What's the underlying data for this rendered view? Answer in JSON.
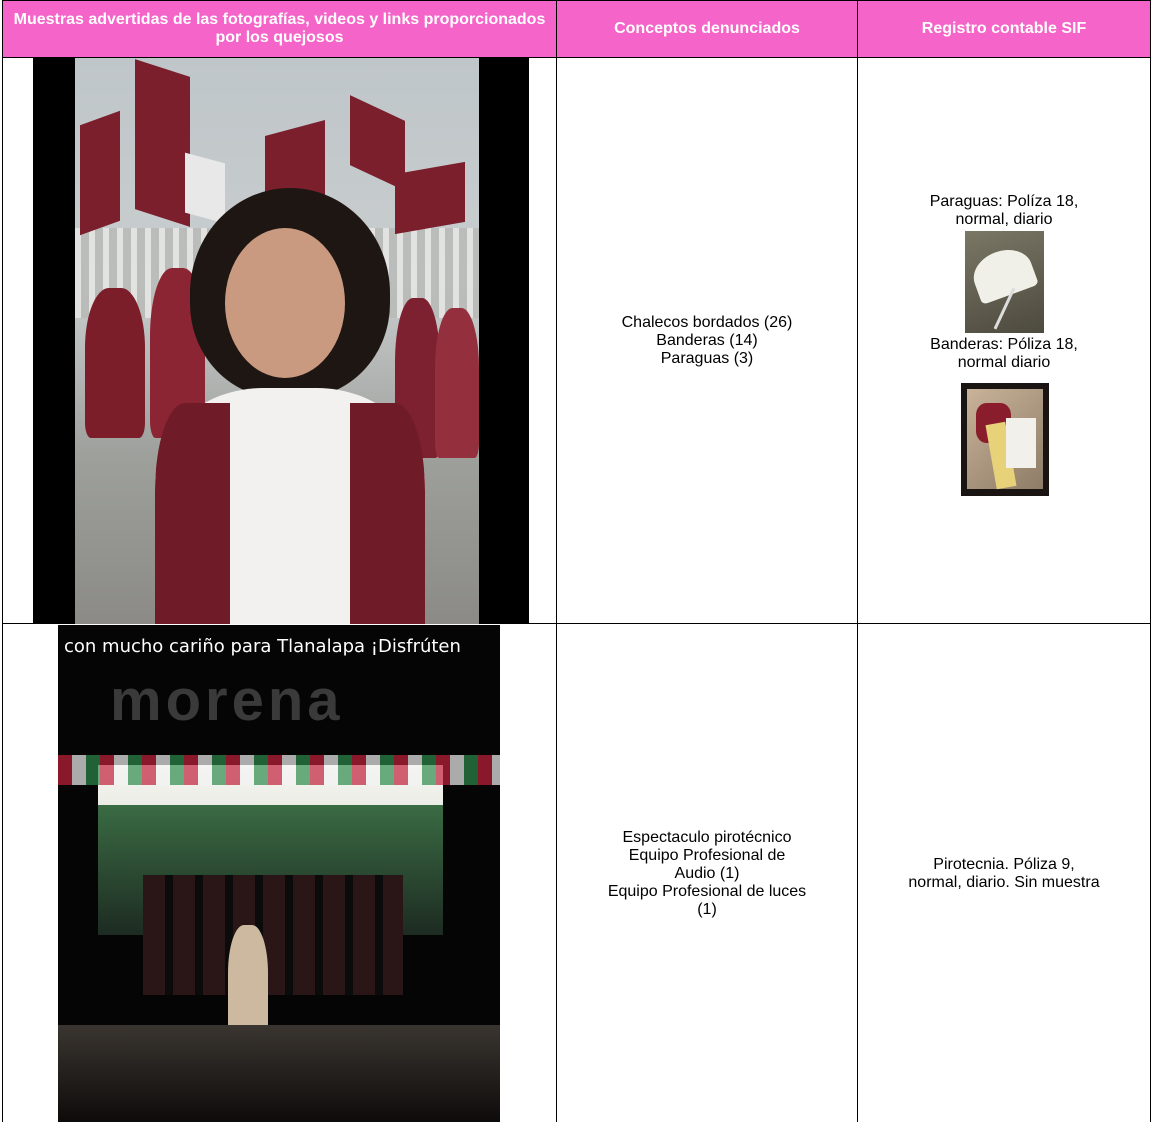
{
  "table": {
    "headers": [
      "Muestras advertidas de las fotografías, videos y links proporcionados por los quejosos",
      "Conceptos denunciados",
      "Registro contable SIF"
    ],
    "header_color": "#f564c8",
    "rows": [
      {
        "concepts": [
          "Chalecos bordados (26)",
          "Banderas (14)",
          "Paraguas (3)"
        ],
        "registro": {
          "entries": [
            {
              "text_lines": [
                "Paraguas: Políza 18,",
                "normal, diario"
              ],
              "image": "umbrella-sample-photo"
            },
            {
              "text_lines": [
                "Banderas: Póliza 18,",
                "normal diario"
              ],
              "image": "flags-sample-photo"
            }
          ]
        },
        "photo": "woman-campaign-rally-photo"
      },
      {
        "video_caption": "con mucho cariño para Tlanalapa ¡Disfrúten",
        "sign_text": "morena",
        "concepts": [
          "Espectaculo pirotécnico",
          "Equipo Profesional de",
          "Audio (1)",
          "Equipo Profesional de luces",
          "(1)"
        ],
        "registro": {
          "text_lines": [
            "Pirotecnia. Póliza 9,",
            "normal, diario. Sin muestra"
          ]
        },
        "photo": "night-event-storefront-photo"
      }
    ]
  }
}
